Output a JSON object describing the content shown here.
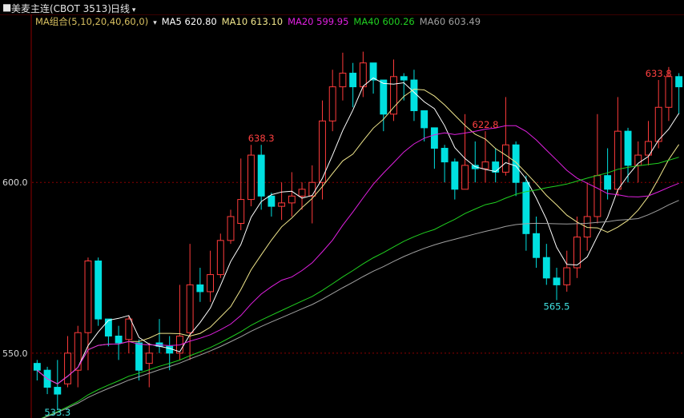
{
  "header": {
    "title": "美麦主连(CBOT 3513)",
    "period": "日线"
  },
  "ma_legend": [
    {
      "label": "MA组合(5,10,20,40,60,0)",
      "color": "#d8c060"
    },
    {
      "label": "MA5 620.80",
      "color": "#ffffff"
    },
    {
      "label": "MA10 613.10",
      "color": "#f0e68c"
    },
    {
      "label": "MA20 599.95",
      "color": "#e020e0"
    },
    {
      "label": "MA40 600.26",
      "color": "#20d020"
    },
    {
      "label": "MA60 603.49",
      "color": "#a0a0a0"
    }
  ],
  "colors": {
    "up": "#ff3b3b",
    "down": "#00e0e0",
    "axis": "#8b0000",
    "grid": "#8b0000",
    "high_label": "#ff4040",
    "low_label": "#40e0e0",
    "ma5": "#ffffff",
    "ma10": "#f0e68c",
    "ma20": "#e020e0",
    "ma40": "#20d020",
    "ma60": "#a0a0a0"
  },
  "chart_data": {
    "type": "candlestick",
    "y_ticks": [
      "600.0",
      "550.0"
    ],
    "y_tick_values": [
      600,
      550
    ],
    "ylim": [
      531,
      645
    ],
    "annotations": [
      {
        "text": "638.3",
        "kind": "high",
        "index": 22
      },
      {
        "text": "622.8",
        "kind": "high",
        "index": 44
      },
      {
        "text": "565.5",
        "kind": "low",
        "index": 51
      },
      {
        "text": "633.8",
        "kind": "high",
        "index": 61
      },
      {
        "text": "533.3",
        "kind": "low",
        "index": 2
      }
    ],
    "candles": [
      [
        547,
        545,
        548,
        542
      ],
      [
        545,
        540,
        546,
        538
      ],
      [
        540,
        538,
        548,
        533.3
      ],
      [
        541,
        550,
        555,
        540
      ],
      [
        545,
        556,
        558,
        540
      ],
      [
        556,
        577,
        578,
        545
      ],
      [
        577,
        560,
        578,
        558
      ],
      [
        560,
        555,
        559,
        552
      ],
      [
        555,
        553,
        558,
        548
      ],
      [
        554,
        560,
        561,
        550
      ],
      [
        553,
        545,
        554,
        542
      ],
      [
        547,
        550,
        553,
        540
      ],
      [
        553,
        552,
        560,
        550
      ],
      [
        552,
        550,
        555,
        545
      ],
      [
        550,
        555,
        570,
        548
      ],
      [
        556,
        570,
        582,
        548
      ],
      [
        570,
        568,
        575,
        565
      ],
      [
        568,
        573,
        580,
        565
      ],
      [
        573,
        583,
        585,
        572
      ],
      [
        583,
        590,
        592,
        582
      ],
      [
        588,
        595,
        607,
        586
      ],
      [
        595,
        608,
        611,
        593
      ],
      [
        608,
        596,
        611,
        592
      ],
      [
        596,
        593,
        597,
        590
      ],
      [
        593,
        594,
        600,
        589
      ],
      [
        594,
        596,
        603,
        590
      ],
      [
        596,
        598,
        600,
        592
      ],
      [
        596,
        600,
        605,
        588
      ],
      [
        600,
        618,
        624,
        595
      ],
      [
        618,
        628,
        633,
        615
      ],
      [
        628,
        632,
        638,
        624
      ],
      [
        632,
        628,
        635,
        622
      ],
      [
        628,
        635,
        638.3,
        625
      ],
      [
        635,
        630,
        634,
        626
      ],
      [
        630,
        620,
        630,
        615
      ],
      [
        620,
        631,
        636,
        618
      ],
      [
        631,
        630,
        632,
        624
      ],
      [
        630,
        621,
        633,
        618
      ],
      [
        621,
        616,
        619,
        612
      ],
      [
        616,
        610,
        614,
        604
      ],
      [
        610,
        606,
        611,
        600
      ],
      [
        606,
        598,
        607,
        595
      ],
      [
        598,
        605,
        620,
        598
      ],
      [
        605,
        604,
        612,
        600
      ],
      [
        604,
        606,
        615,
        600
      ],
      [
        606,
        603,
        610,
        600
      ],
      [
        603,
        611,
        625,
        602
      ],
      [
        611,
        600,
        612,
        596
      ]
    ],
    "x_count": 64
  }
}
